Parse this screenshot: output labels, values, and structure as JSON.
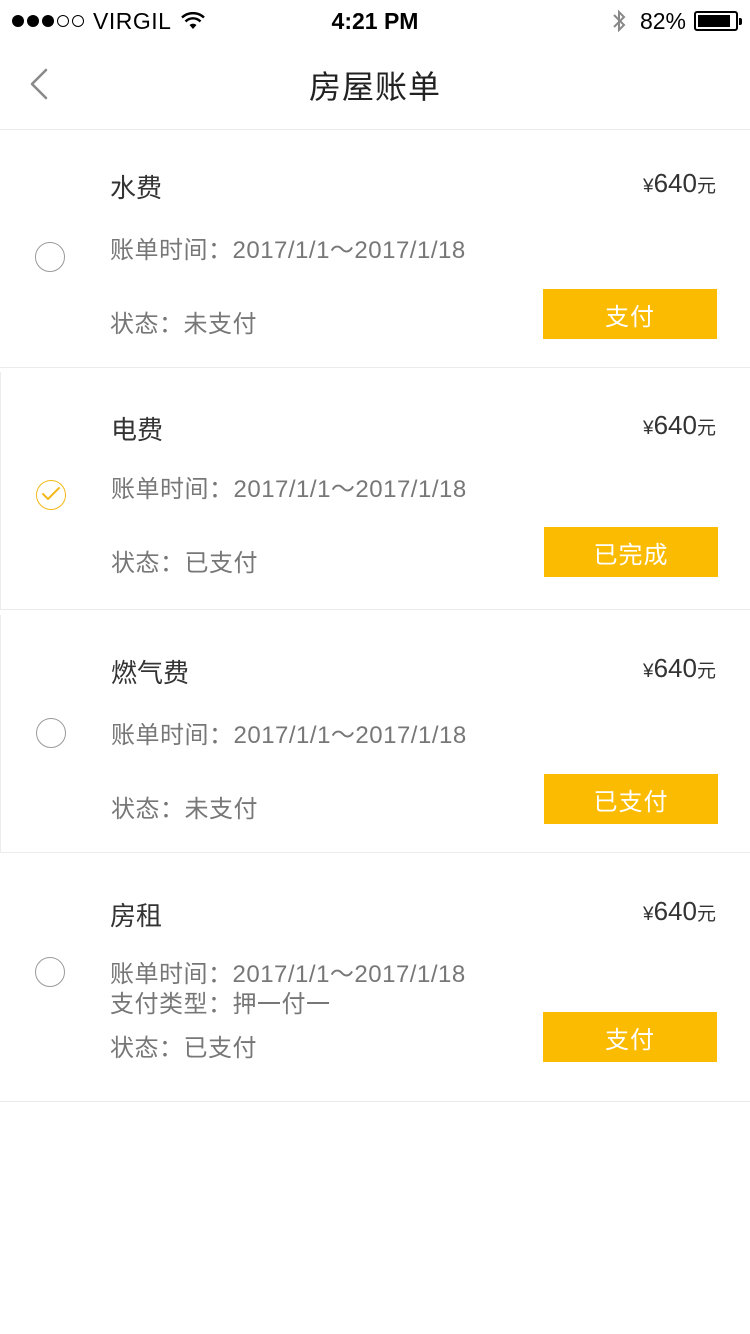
{
  "status_bar": {
    "carrier": "VIRGIL",
    "time": "4:21 PM",
    "battery": "82%"
  },
  "nav": {
    "title": "房屋账单"
  },
  "colors": {
    "accent": "#fbbb00",
    "checked_radio": "#f3b91a"
  },
  "bills": [
    {
      "name": "水费",
      "currency": "¥",
      "amount": "640",
      "unit": "元",
      "time_label": "账单时间：",
      "time_value": "2017/1/1～2017/1/18",
      "status_label": "状态：",
      "status_value": "未支付",
      "button": "支付",
      "selected": false
    },
    {
      "name": "电费",
      "currency": "¥",
      "amount": "640",
      "unit": "元",
      "time_label": "账单时间：",
      "time_value": "2017/1/1～2017/1/18",
      "status_label": "状态：",
      "status_value": "已支付",
      "button": "已完成",
      "selected": true
    },
    {
      "name": "燃气费",
      "currency": "¥",
      "amount": "640",
      "unit": "元",
      "time_label": "账单时间：",
      "time_value": "2017/1/1～2017/1/18",
      "status_label": "状态：",
      "status_value": "未支付",
      "button": "已支付",
      "selected": false
    },
    {
      "name": "房租",
      "currency": "¥",
      "amount": "640",
      "unit": "元",
      "time_label": "账单时间：",
      "time_value": "2017/1/1～2017/1/18",
      "pay_type_label": "支付类型：",
      "pay_type_value": "押一付一",
      "status_label": "状态：",
      "status_value": "已支付",
      "button": "支付",
      "selected": false
    }
  ]
}
